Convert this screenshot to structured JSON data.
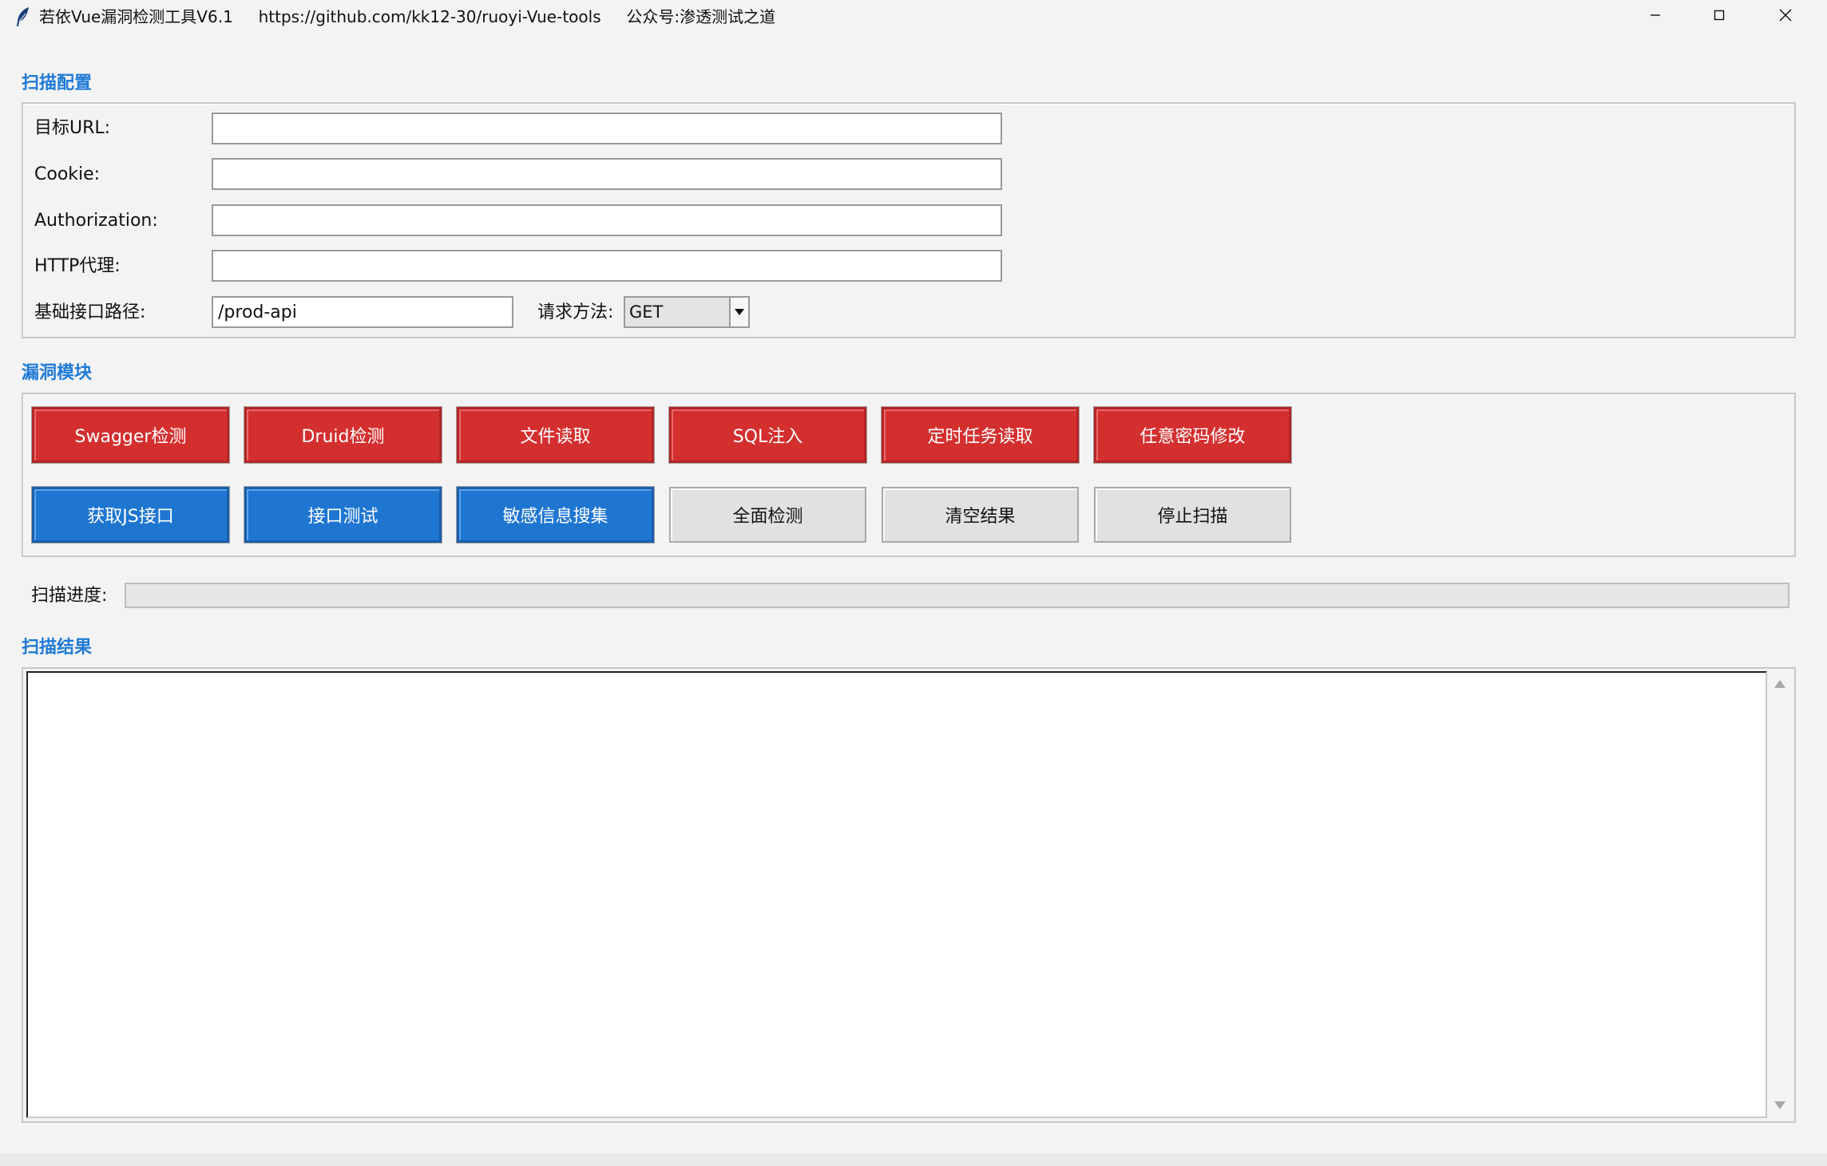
{
  "window": {
    "title": "若依Vue漏洞检测工具V6.1     https://github.com/kk12-30/ruoyi-Vue-tools     公众号:渗透测试之道",
    "app_icon": "feather-icon",
    "controls": {
      "minimize": "minimize-icon",
      "maximize": "maximize-icon",
      "close": "close-icon"
    }
  },
  "scan_config": {
    "section_title": "扫描配置",
    "fields": {
      "target_url": {
        "label": "目标URL:",
        "value": ""
      },
      "cookie": {
        "label": "Cookie:",
        "value": ""
      },
      "authorization": {
        "label": "Authorization:",
        "value": ""
      },
      "http_proxy": {
        "label": "HTTP代理:",
        "value": ""
      },
      "base_path": {
        "label": "基础接口路径:",
        "value": "/prod-api"
      }
    },
    "request_method": {
      "label": "请求方法:",
      "selected": "GET"
    }
  },
  "modules": {
    "section_title": "漏洞模块",
    "row1": [
      {
        "label": "Swagger检测",
        "style": "red"
      },
      {
        "label": "Druid检测",
        "style": "red"
      },
      {
        "label": "文件读取",
        "style": "red"
      },
      {
        "label": "SQL注入",
        "style": "red"
      },
      {
        "label": "定时任务读取",
        "style": "red"
      },
      {
        "label": "任意密码修改",
        "style": "red"
      }
    ],
    "row2": [
      {
        "label": "获取JS接口",
        "style": "blue"
      },
      {
        "label": "接口测试",
        "style": "blue"
      },
      {
        "label": "敏感信息搜集",
        "style": "blue"
      },
      {
        "label": "全面检测",
        "style": "gray"
      },
      {
        "label": "清空结果",
        "style": "gray"
      },
      {
        "label": "停止扫描",
        "style": "gray"
      }
    ]
  },
  "progress": {
    "label": "扫描进度:",
    "value": 0
  },
  "results": {
    "section_title": "扫描结果",
    "content": ""
  },
  "colors": {
    "accent": "#1f7ad6",
    "red_button": "#d42f2f",
    "blue_button": "#1f76d1",
    "gray_button": "#e1e1e1"
  }
}
